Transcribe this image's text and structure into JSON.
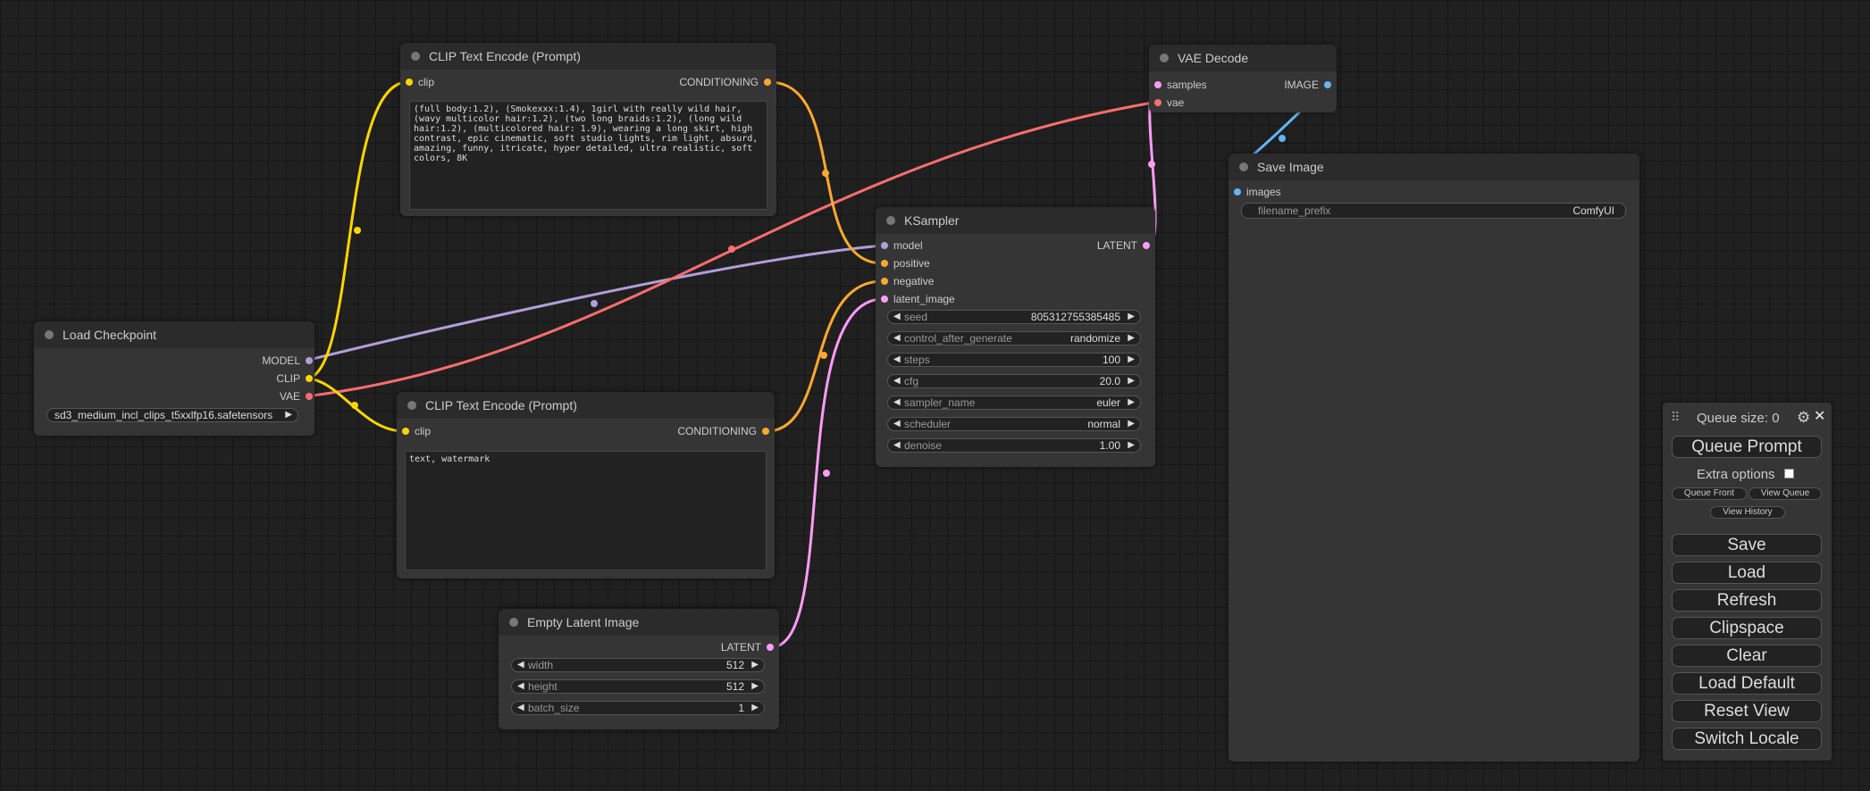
{
  "colors": {
    "clip": "#ffd500",
    "conditioning": "#ffa931",
    "model": "#b39ddb",
    "vae": "#ff6e6e",
    "latent": "#ff9cf9",
    "image": "#64b5f6"
  },
  "nodes": {
    "load_checkpoint": {
      "title": "Load Checkpoint",
      "outputs": [
        "MODEL",
        "CLIP",
        "VAE"
      ],
      "ckpt_name": "sd3_medium_incl_clips_t5xxlfp16.safetensors"
    },
    "clip_pos": {
      "title": "CLIP Text Encode (Prompt)",
      "input": "clip",
      "output": "CONDITIONING",
      "text": "(full body:1.2), (Smokexxx:1.4), 1girl with really wild hair, (wavy multicolor hair:1.2), (two long braids:1.2), (long wild hair:1.2), (multicolored hair: 1.9), wearing a long skirt, high contrast, epic cinematic, soft studio lights, rim light, absurd, amazing, funny, itricate, hyper detailed, ultra realistic, soft colors, 8K"
    },
    "clip_neg": {
      "title": "CLIP Text Encode (Prompt)",
      "input": "clip",
      "output": "CONDITIONING",
      "text": "text, watermark"
    },
    "ksampler": {
      "title": "KSampler",
      "inputs": [
        "model",
        "positive",
        "negative",
        "latent_image"
      ],
      "output": "LATENT",
      "widgets": [
        {
          "name": "seed",
          "value": "805312755385485"
        },
        {
          "name": "control_after_generate",
          "value": "randomize"
        },
        {
          "name": "steps",
          "value": "100"
        },
        {
          "name": "cfg",
          "value": "20.0"
        },
        {
          "name": "sampler_name",
          "value": "euler"
        },
        {
          "name": "scheduler",
          "value": "normal"
        },
        {
          "name": "denoise",
          "value": "1.00"
        }
      ]
    },
    "empty_latent": {
      "title": "Empty Latent Image",
      "output": "LATENT",
      "widgets": [
        {
          "name": "width",
          "value": "512"
        },
        {
          "name": "height",
          "value": "512"
        },
        {
          "name": "batch_size",
          "value": "1"
        }
      ]
    },
    "vae_decode": {
      "title": "VAE Decode",
      "inputs": [
        "samples",
        "vae"
      ],
      "output": "IMAGE"
    },
    "save_image": {
      "title": "Save Image",
      "input": "images",
      "widget": {
        "name": "filename_prefix",
        "value": "ComfyUI"
      }
    }
  },
  "menu": {
    "queue_size": "Queue size: 0",
    "queue_prompt": "Queue Prompt",
    "extra_options": "Extra options",
    "queue_front": "Queue Front",
    "view_queue": "View Queue",
    "view_history": "View History",
    "buttons": [
      "Save",
      "Load",
      "Refresh",
      "Clipspace",
      "Clear",
      "Load Default",
      "Reset View",
      "Switch Locale"
    ]
  }
}
